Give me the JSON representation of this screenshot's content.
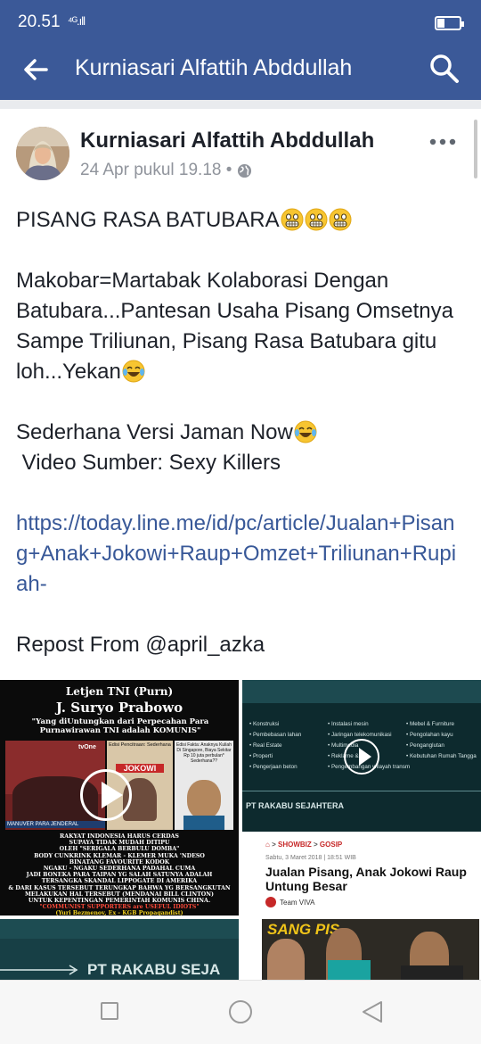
{
  "status_bar": {
    "time": "20.51",
    "signal": "⁴ᴳ.ıll"
  },
  "app_bar": {
    "title": "Kurniasari Alfattih Abddullah",
    "back_icon": "arrow-left-icon",
    "search_icon": "search-icon",
    "color": "#3b5998"
  },
  "post": {
    "author": "Kurniasari Alfattih Abddullah",
    "date": "24 Apr pukul 19.18 •",
    "privacy_icon": "globe-icon",
    "more_icon": "more-horizontal-icon",
    "headline": "PISANG RASA BATUBARA",
    "paragraph_1": "Makobar=Martabak Kolaborasi Dengan Batubara...Pantesan Usaha Pisang Omsetnya Sampe Triliunan, Pisang Rasa Batubara gitu loh...Yekan",
    "paragraph_2_line_1": "Sederhana Versi Jaman Now",
    "paragraph_2_line_2": " Video Sumber: Sexy Killers",
    "link": "https://today.line.me/id/pc/article/Jualan+Pisang+Anak+Jokowi+Raup+Omzet+Triliunan+Rupiah-",
    "repost": "Repost From @april_azka",
    "link_color": "#385898"
  },
  "media": {
    "tile_1": {
      "title_1": "Letjen TNI (Purn)",
      "title_2": "J. Suryo Prabowo",
      "quote": "\"Yang diUntungkan dari Perpecahan Para Purnawirawan TNI adalah KOMUNIS\"",
      "channel": "tvOne",
      "caption_left": "MANUVER PARA JENDERAL",
      "edisi_1": "Edisi Pencitraan: Sederhana",
      "edisi_2": "Edisi Fakta: Anaknya Kuliah Di Singapore, Biaya Sekitar Rp 10 juta perbulan* Sederhana??",
      "poster": "JOKOWI",
      "lines": [
        "RAKYAT INDONESIA HARUS CERDAS",
        "SUPAYA TIDAK MUDAH DITIPU",
        "OLEH \"SERIGALA BERBULU DOMBA\"",
        "BODY CUNKRINK KLEMAR - KLEMER MUKA 'NDESO",
        "BINATANG FAVOURITE KODOK",
        "NGAKU - NGAKU SEDERHANA PADAHAL CUMA",
        "JADI BONEKA PARA TAIPAN YG SALAH SATUNYA ADALAH",
        "TERSANGKA SKANDAL LIPPOGATE DI AMERIKA",
        "& DARI KASUS TERSEBUT TERUNGKAP BAHWA YG BERSANGKUTAN",
        "MELAKUKAN HAL TERSEBUT (MENDANAI BILL CLINTON)",
        "UNTUK KEPENTINGAN PEMERINTAH KOMUNIS CHINA.",
        "\"COMMUNIST SUPPORTERS are USEFUL IDIOTS\"",
        "(Yuri Bezmenov, Ex - KGB Propagandist)"
      ]
    },
    "tile_2": {
      "col_1": [
        "Konstruksi",
        "Pembebasan lahan",
        "Real Estate",
        "Properti",
        "Pengerjaan beton"
      ],
      "col_2": [
        "Instalasi mesin",
        "Jaringan telekomunikasi",
        "Multimedia",
        "Reklame & ...",
        "Pengembangan wilayah transmigrasi"
      ],
      "col_3": [
        "Mebel & Furniture",
        "Pengolahan kayu",
        "Penganglutan",
        "Kebutuhan Rumah Tangga"
      ],
      "company": "PT RAKABU SEJAHTERA"
    },
    "tile_3": {
      "breadcrumb_1": "SHOWBIZ",
      "breadcrumb_2": "GOSIP",
      "date": "Sabtu, 3 Maret 2018 | 18:51 WIB",
      "headline": "Jualan Pisang, Anak Jokowi Raup Untung Besar",
      "source": "Team VIVA",
      "sign": "SANG PIS"
    },
    "tile_4": {
      "company": "PT RAKABU SEJA"
    }
  },
  "nav_bar": {
    "recents_icon": "square-icon",
    "home_icon": "circle-icon",
    "back_icon": "triangle-back-icon"
  }
}
